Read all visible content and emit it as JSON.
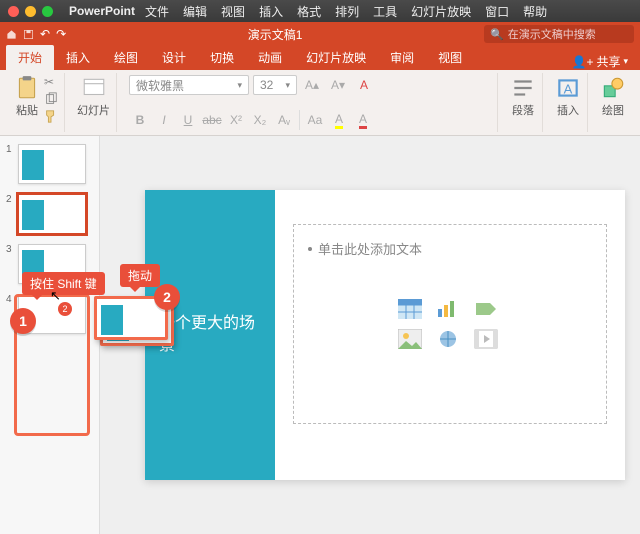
{
  "app": {
    "name": "PowerPoint"
  },
  "menubar": [
    "文件",
    "编辑",
    "视图",
    "插入",
    "格式",
    "排列",
    "工具",
    "幻灯片放映",
    "窗口",
    "帮助"
  ],
  "document": {
    "title": "演示文稿1"
  },
  "search": {
    "placeholder": "在演示文稿中搜索"
  },
  "tabs": [
    "开始",
    "插入",
    "绘图",
    "设计",
    "切换",
    "动画",
    "幻灯片放映",
    "审阅",
    "视图"
  ],
  "active_tab": "开始",
  "share": "共享",
  "ribbon": {
    "paste": "粘贴",
    "slide": "幻灯片",
    "font_name": "微软雅黑",
    "font_size": "32",
    "paragraph": "段落",
    "insert": "插入",
    "draw": "绘图",
    "buttons": {
      "bold": "B",
      "italic": "I",
      "underline": "U",
      "strike": "abc",
      "sup": "X²",
      "sub": "X₂",
      "spacing": "Aᵥ",
      "caseA": "Aa",
      "clearFmt": "A"
    }
  },
  "thumbs": [
    {
      "num": "1"
    },
    {
      "num": "2"
    },
    {
      "num": "3"
    },
    {
      "num": "4"
    }
  ],
  "annotations": {
    "hold_shift": "按住 Shift 键",
    "drag": "拖动",
    "badge1": "1",
    "badge2": "2",
    "tiny2": "2"
  },
  "slide_content": {
    "title": "一个更大的场景",
    "placeholder": "单击此处添加文本"
  }
}
